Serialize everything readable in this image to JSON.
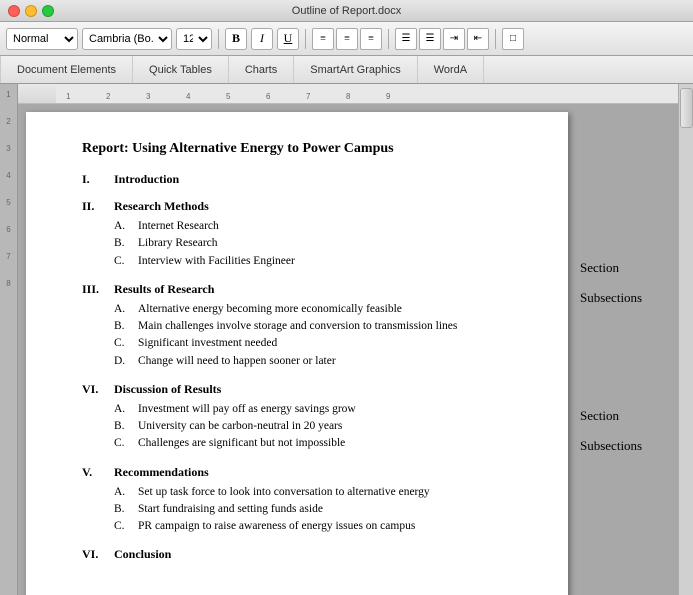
{
  "titleBar": {
    "title": "Outline of Report.docx",
    "trafficLights": [
      "red",
      "yellow",
      "green"
    ]
  },
  "toolbar": {
    "styleSelect": "Normal",
    "fontSelect": "Cambria (Bo...",
    "sizeSelect": "12",
    "boldLabel": "B",
    "italicLabel": "I",
    "underlineLabel": "U"
  },
  "ribbon": {
    "tabs": [
      {
        "label": "Document Elements",
        "active": false
      },
      {
        "label": "Quick Tables",
        "active": false
      },
      {
        "label": "Charts",
        "active": false
      },
      {
        "label": "SmartArt Graphics",
        "active": false
      },
      {
        "label": "WordA",
        "active": false
      }
    ]
  },
  "document": {
    "title": "Report: Using Alternative Energy to Power Campus",
    "sections": [
      {
        "num": "I.",
        "heading": "Introduction",
        "items": []
      },
      {
        "num": "II.",
        "heading": "Research Methods",
        "items": [
          {
            "letter": "A.",
            "text": "Internet Research"
          },
          {
            "letter": "B.",
            "text": "Library Research"
          },
          {
            "letter": "C.",
            "text": "Interview with Facilities Engineer"
          }
        ]
      },
      {
        "num": "III.",
        "heading": "Results of Research",
        "items": [
          {
            "letter": "A.",
            "text": "Alternative energy becoming more economically feasible"
          },
          {
            "letter": "B.",
            "text": "Main challenges involve storage and conversion to transmission lines"
          },
          {
            "letter": "C.",
            "text": "Significant investment needed"
          },
          {
            "letter": "D.",
            "text": "Change will need to happen sooner or later"
          }
        ]
      },
      {
        "num": "VI.",
        "heading": "Discussion of Results",
        "items": [
          {
            "letter": "A.",
            "text": "Investment will pay off as energy savings grow"
          },
          {
            "letter": "B.",
            "text": "University can be carbon-neutral in 20 years"
          },
          {
            "letter": "C.",
            "text": "Challenges are significant but not impossible"
          }
        ]
      },
      {
        "num": "V.",
        "heading": "Recommendations",
        "items": [
          {
            "letter": "A.",
            "text": "Set up task force to look into conversation to alternative energy"
          },
          {
            "letter": "B.",
            "text": "Start fundraising and setting funds aside"
          },
          {
            "letter": "C.",
            "text": "PR campaign to raise awareness of energy issues on campus"
          }
        ]
      },
      {
        "num": "VI.",
        "heading": "Conclusion",
        "items": []
      }
    ]
  },
  "annotations": [
    {
      "id": "ann1",
      "text": "Section",
      "topOffset": 148
    },
    {
      "id": "ann2",
      "text": "Subsections",
      "topOffset": 172
    },
    {
      "id": "ann3",
      "text": "Section",
      "topOffset": 282
    },
    {
      "id": "ann4",
      "text": "Subsections",
      "topOffset": 306
    }
  ]
}
